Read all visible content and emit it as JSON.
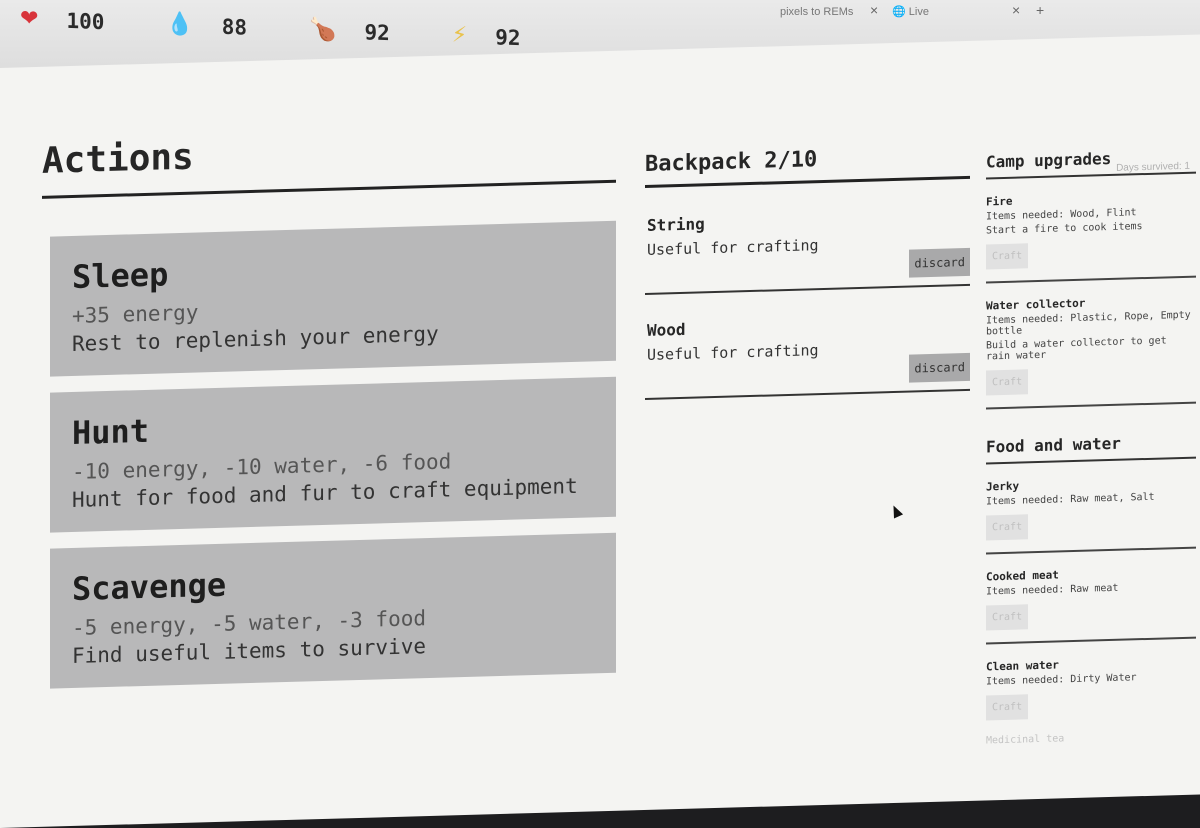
{
  "browser": {
    "tabs": [
      {
        "label": "pixels to REMs",
        "close": "×"
      },
      {
        "label": "Live",
        "close": "×"
      }
    ],
    "new_tab": "+",
    "toolbar_icons": [
      "★",
      "●",
      "○",
      "◆",
      "●",
      "○",
      "▼",
      "■",
      "●"
    ]
  },
  "stats": [
    {
      "icon": "heart-icon",
      "glyph": "❤",
      "color": "#d8343b",
      "value": "100"
    },
    {
      "icon": "water-drop-icon",
      "glyph": "💧",
      "color": "#3c8fd6",
      "value": "88"
    },
    {
      "icon": "drumstick-icon",
      "glyph": "🍗",
      "color": "#7b4a2a",
      "value": "92"
    },
    {
      "icon": "lightning-icon",
      "glyph": "⚡",
      "color": "#e9c24b",
      "value": "92"
    }
  ],
  "hint": "Days survived: 1",
  "actions": {
    "title": "Actions",
    "items": [
      {
        "name": "Sleep",
        "cost": "+35 energy",
        "desc": "Rest to replenish your energy"
      },
      {
        "name": "Hunt",
        "cost": "-10 energy, -10 water, -6 food",
        "desc": "Hunt for food and fur to craft equipment"
      },
      {
        "name": "Scavenge",
        "cost": "-5 energy, -5 water, -3 food",
        "desc": "Find useful items to survive"
      }
    ]
  },
  "backpack": {
    "title": "Backpack 2/10",
    "discard_label": "discard",
    "items": [
      {
        "name": "String",
        "desc": "Useful for crafting"
      },
      {
        "name": "Wood",
        "desc": "Useful for crafting"
      }
    ]
  },
  "camp": {
    "title": "Camp upgrades",
    "craft_label": "Craft",
    "items": [
      {
        "name": "Fire",
        "needed": "Items needed: Wood, Flint",
        "desc": "Start a fire to cook items"
      },
      {
        "name": "Water collector",
        "needed": "Items needed: Plastic, Rope, Empty bottle",
        "desc": "Build a water collector to get rain water"
      }
    ]
  },
  "food": {
    "title": "Food and water",
    "craft_label": "Craft",
    "items": [
      {
        "name": "Jerky",
        "needed": "Items needed: Raw meat, Salt"
      },
      {
        "name": "Cooked meat",
        "needed": "Items needed: Raw meat"
      },
      {
        "name": "Clean water",
        "needed": "Items needed: Dirty Water"
      }
    ]
  },
  "footer_hint": "Medicinal tea"
}
